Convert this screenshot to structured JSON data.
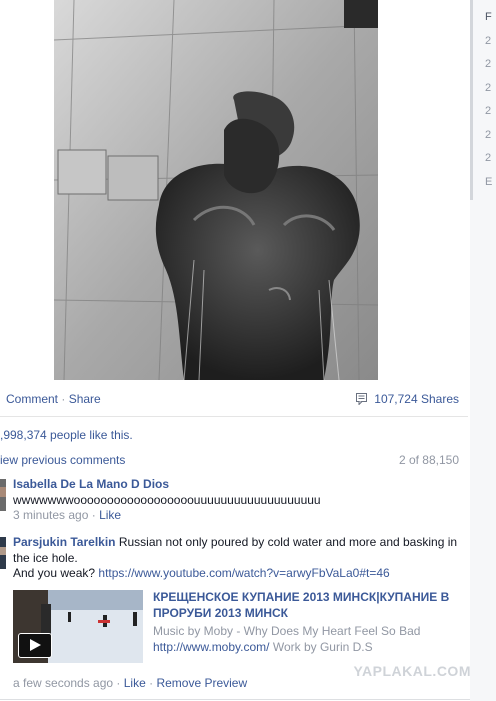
{
  "sidebar": {
    "items": [
      "F",
      "2",
      "2",
      "2",
      "2",
      "2",
      "2",
      "E"
    ]
  },
  "photo": {
    "alt_icon": "shower-photo"
  },
  "actions": {
    "comment_label": "Comment",
    "separator": " · ",
    "share_label": "Share",
    "share_count": "107,724 Shares"
  },
  "likes": {
    "text": ",998,374 people like this."
  },
  "previous_comments": {
    "label": "iew previous comments",
    "count": "2 of 88,150"
  },
  "comments": [
    {
      "author": "Isabella De La Mano D Dios",
      "text": "wwwwwwwoooooooooooooooooouuuuuuuuuuuuuuuuuuu",
      "time": "3 minutes ago",
      "like_label": "Like"
    },
    {
      "author": "Parsjukin Tarelkin",
      "text": "Russian not only poured by cold water and more and basking in the ice hole.",
      "text2": "And you weak?",
      "link": "https://www.youtube.com/watch?v=arwyFbVaLa0#t=46",
      "preview": {
        "title": "КРЕЩЕНСКОЕ КУПАНИЕ 2013 МИНСК|КУПАНИЕ В ПРОРУБИ 2013 МИНСК",
        "music_prefix": "Music by Moby - Why Does My Heart Feel So Bad",
        "url": "http://www.moby.com/",
        "work": "Work by Gurin D.S"
      },
      "time": "a few seconds ago",
      "like_label": "Like",
      "remove_label": "Remove Preview"
    }
  ],
  "watermark": "YAPLAKAL.COM"
}
